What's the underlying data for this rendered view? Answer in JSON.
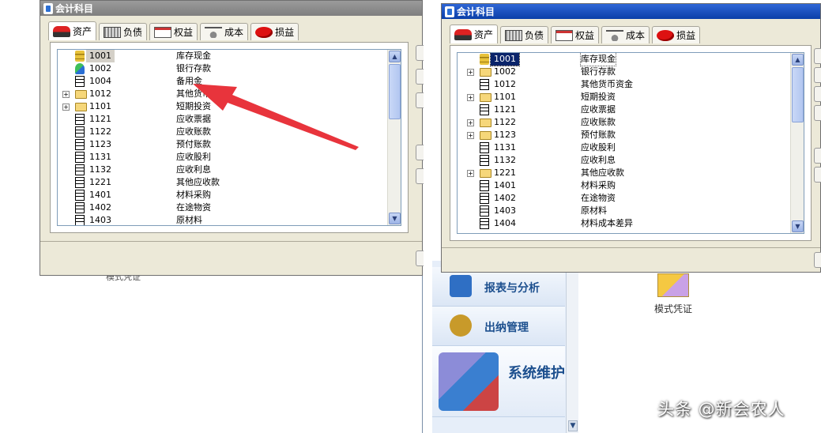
{
  "tabs": [
    "资产",
    "负债",
    "权益",
    "成本",
    "损益"
  ],
  "tab_icons": [
    "car-icon",
    "keyboard-icon",
    "calendar-icon",
    "scale-icon",
    "apple-icon"
  ],
  "left_dialog": {
    "title": "会计科目",
    "rows": [
      {
        "code": "1001",
        "name": "库存现金",
        "icon": "coins",
        "expand": false,
        "selected": true
      },
      {
        "code": "1002",
        "name": "银行存款",
        "icon": "bank",
        "expand": false
      },
      {
        "code": "1004",
        "name": "备用金",
        "icon": "file",
        "expand": false
      },
      {
        "code": "1012",
        "name": "其他货币资金",
        "icon": "folder",
        "expand": true
      },
      {
        "code": "1101",
        "name": "短期投资",
        "icon": "folder",
        "expand": true
      },
      {
        "code": "1121",
        "name": "应收票据",
        "icon": "file",
        "expand": false
      },
      {
        "code": "1122",
        "name": "应收账款",
        "icon": "file",
        "expand": false
      },
      {
        "code": "1123",
        "name": "预付账款",
        "icon": "file",
        "expand": false
      },
      {
        "code": "1131",
        "name": "应收股利",
        "icon": "file",
        "expand": false
      },
      {
        "code": "1132",
        "name": "应收利息",
        "icon": "file",
        "expand": false
      },
      {
        "code": "1221",
        "name": "其他应收款",
        "icon": "file",
        "expand": false
      },
      {
        "code": "1401",
        "name": "材料采购",
        "icon": "file",
        "expand": false
      },
      {
        "code": "1402",
        "name": "在途物资",
        "icon": "file",
        "expand": false
      },
      {
        "code": "1403",
        "name": "原材料",
        "icon": "file",
        "expand": false
      }
    ]
  },
  "right_dialog": {
    "title": "会计科目",
    "rows": [
      {
        "code": "1001",
        "name": "库存现金",
        "icon": "coins",
        "expand": false,
        "selected": true
      },
      {
        "code": "1002",
        "name": "银行存款",
        "icon": "folder",
        "expand": true
      },
      {
        "code": "1012",
        "name": "其他货币资金",
        "icon": "file",
        "expand": false
      },
      {
        "code": "1101",
        "name": "短期投资",
        "icon": "folder",
        "expand": true
      },
      {
        "code": "1121",
        "name": "应收票据",
        "icon": "file",
        "expand": false
      },
      {
        "code": "1122",
        "name": "应收账款",
        "icon": "folder",
        "expand": true
      },
      {
        "code": "1123",
        "name": "预付账款",
        "icon": "folder",
        "expand": true
      },
      {
        "code": "1131",
        "name": "应收股利",
        "icon": "file",
        "expand": false
      },
      {
        "code": "1132",
        "name": "应收利息",
        "icon": "file",
        "expand": false
      },
      {
        "code": "1221",
        "name": "其他应收款",
        "icon": "folder",
        "expand": true
      },
      {
        "code": "1401",
        "name": "材料采购",
        "icon": "file",
        "expand": false
      },
      {
        "code": "1402",
        "name": "在途物资",
        "icon": "file",
        "expand": false
      },
      {
        "code": "1403",
        "name": "原材料",
        "icon": "file",
        "expand": false
      },
      {
        "code": "1404",
        "name": "材料成本差异",
        "icon": "file",
        "expand": false
      }
    ]
  },
  "background": {
    "sidebar": [
      "报表与分析",
      "出纳管理",
      "系统维护"
    ],
    "sidebar_icons": [
      "report-icon",
      "cashier-icon",
      "system-maintenance-icon"
    ],
    "mode_voucher": "模式凭证",
    "left_ghost_text": "模式凭证",
    "watermark": "头条 @新会农人"
  },
  "colors": {
    "active_title": "#0a3fa8",
    "inactive_title": "#7f7f7f",
    "selection": "#0a246a",
    "annotation_arrow": "#e8343c"
  }
}
